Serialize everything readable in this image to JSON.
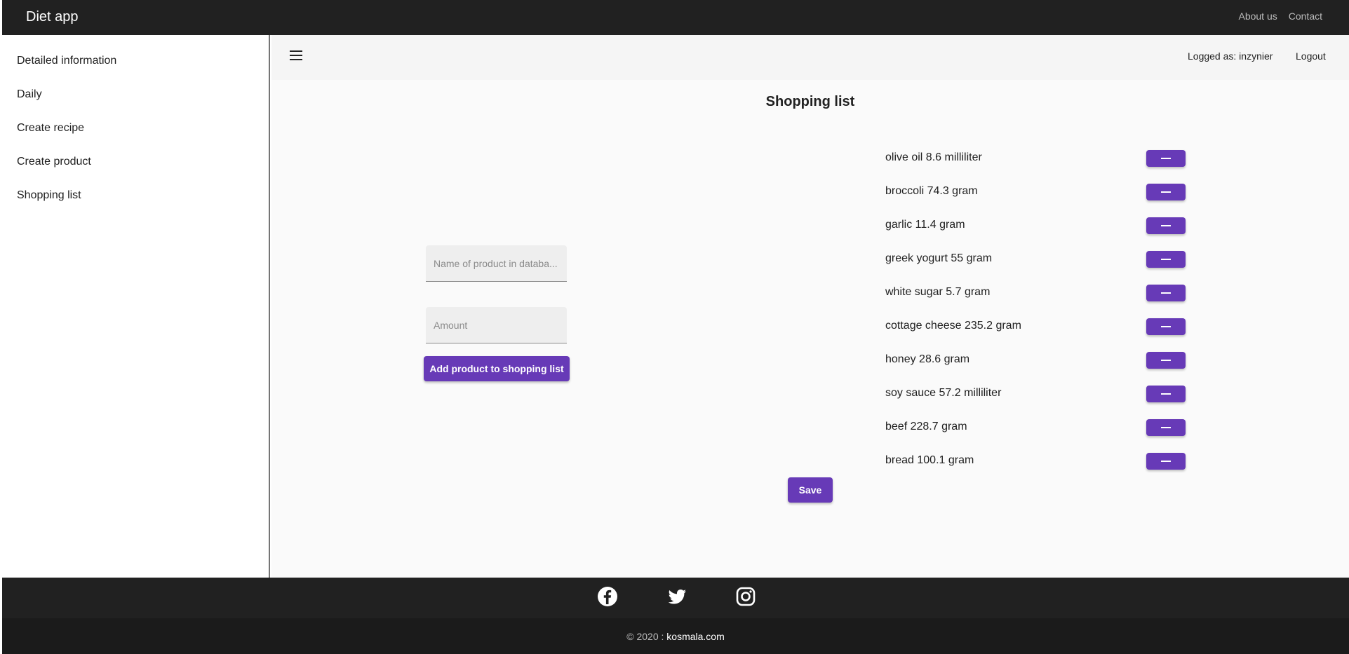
{
  "header": {
    "brand": "Diet app",
    "nav": [
      "About us",
      "Contact"
    ]
  },
  "sidebar": {
    "items": [
      {
        "label": "Detailed information"
      },
      {
        "label": "Daily"
      },
      {
        "label": "Create recipe"
      },
      {
        "label": "Create product"
      },
      {
        "label": "Shopping list"
      }
    ]
  },
  "toolbar": {
    "logged_as": "Logged as: inzynier",
    "logout": "Logout"
  },
  "page": {
    "title": "Shopping list",
    "product_placeholder": "Name of product in databa...",
    "amount_placeholder": "Amount",
    "product_value": "",
    "amount_value": "",
    "add_button": "Add product to shopping list",
    "save_button": "Save"
  },
  "shopping_list": [
    {
      "text": "olive oil 8.6 milliliter"
    },
    {
      "text": "broccoli 74.3 gram"
    },
    {
      "text": "garlic 11.4 gram"
    },
    {
      "text": "greek yogurt 55 gram"
    },
    {
      "text": "white sugar 5.7 gram"
    },
    {
      "text": "cottage cheese 235.2 gram"
    },
    {
      "text": "honey 28.6 gram"
    },
    {
      "text": "soy sauce 57.2 milliliter"
    },
    {
      "text": "beef 228.7 gram"
    },
    {
      "text": "bread 100.1 gram"
    }
  ],
  "footer": {
    "socials": [
      "facebook-icon",
      "twitter-icon",
      "instagram-icon"
    ],
    "copyright_prefix": "© 2020 : ",
    "copyright_link": "kosmala.com"
  },
  "colors": {
    "accent": "#673ab7",
    "topbar": "#212121",
    "footer": "#212121"
  }
}
